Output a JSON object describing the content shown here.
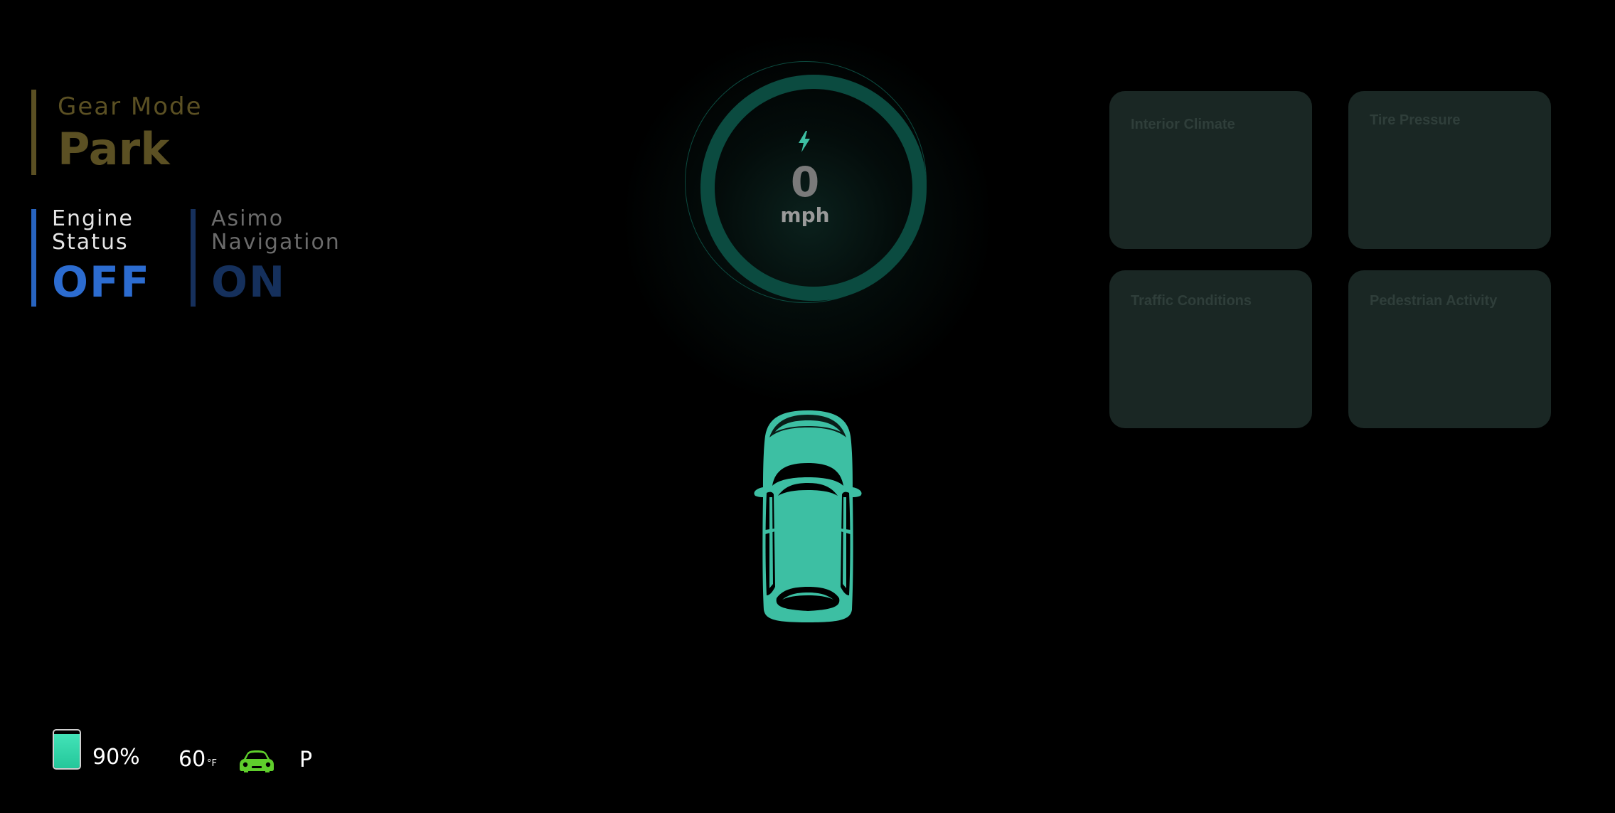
{
  "gear_mode": {
    "caption": "Gear Mode",
    "value": "Park",
    "color": "#5b5023"
  },
  "engine_status": {
    "caption": "Engine Status",
    "value": "OFF",
    "accent": "#2c6cd0"
  },
  "navigation": {
    "caption": "Asimo Navigation",
    "value": "ON",
    "accent": "#15305c"
  },
  "speedometer": {
    "speed": "0",
    "unit": "mph",
    "icon": "lightning-bolt-icon",
    "accent": "#0b4b40"
  },
  "vehicle": {
    "icon": "car-top-view-icon",
    "color": "#3dbfa3"
  },
  "cards": [
    {
      "title": "Interior Climate"
    },
    {
      "title": "Tire Pressure"
    },
    {
      "title": "Traffic Conditions"
    },
    {
      "title": "Pedestrian Activity"
    }
  ],
  "bottom_bar": {
    "battery_level": 0.9,
    "battery_label": "90%",
    "temperature": "60",
    "temperature_unit": "°F",
    "car_status_icon": "car-front-icon",
    "car_status_color": "#5fce2c",
    "gear_indicator": "P"
  }
}
